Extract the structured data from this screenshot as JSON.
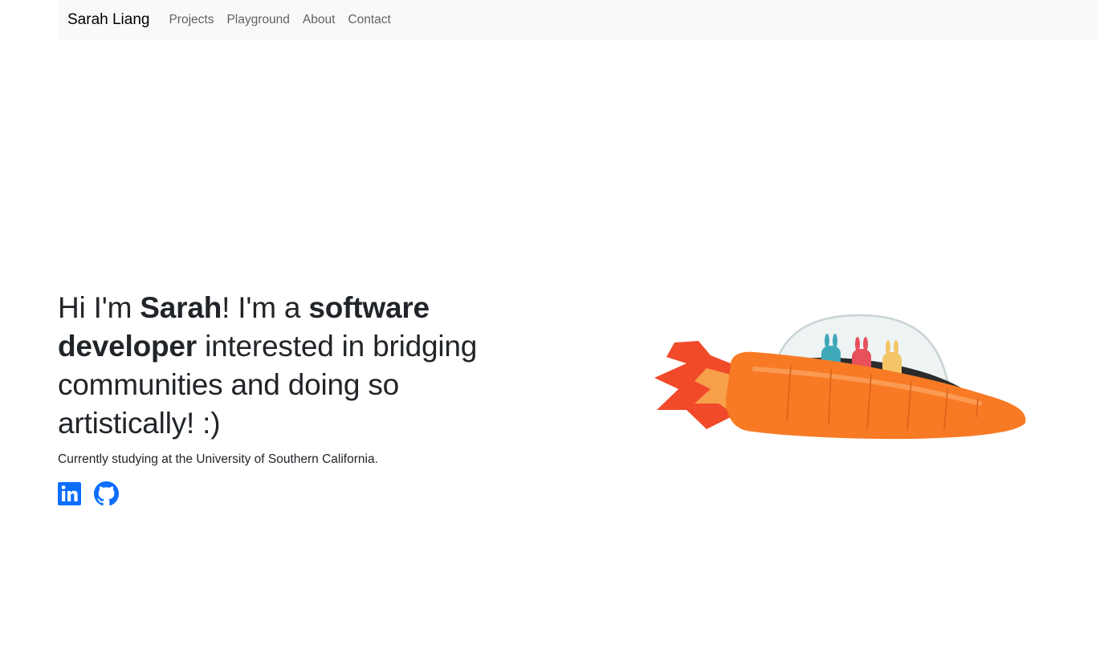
{
  "nav": {
    "brand": "Sarah Liang",
    "links": [
      "Projects",
      "Playground",
      "About",
      "Contact"
    ]
  },
  "hero": {
    "headline_parts": [
      "Hi I'm ",
      "Sarah",
      "! I'm a ",
      "software developer",
      " interested in bridging communities and doing so artistically! :)"
    ],
    "subtext": "Currently studying at the University of Southern California."
  },
  "socials": {
    "icons": [
      "linkedin-icon",
      "github-icon"
    ]
  },
  "illustration": {
    "subject": "carrot rocket ship with three bunnies"
  },
  "colors": {
    "navbar_bg": "#f8f9fa",
    "icon_blue": "#0d6efd",
    "carrot_orange": "#f97a24",
    "flame_red": "#f04a2a",
    "bunny_teal": "#3ea8b8",
    "bunny_red": "#e8505b",
    "bunny_yellow": "#f3c566"
  }
}
